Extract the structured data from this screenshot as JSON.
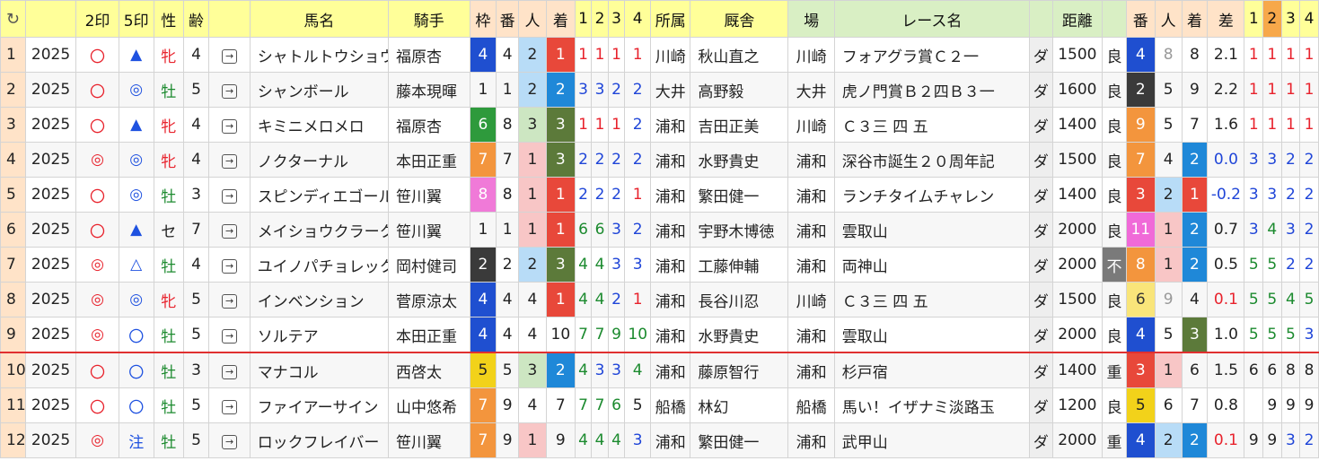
{
  "headers": {
    "refresh": "↻",
    "blank": "",
    "mark2": "2印",
    "mark5": "5印",
    "sex": "性",
    "age": "齢",
    "link": "",
    "horse": "馬名",
    "jockey": "騎手",
    "frame": "枠",
    "number": "番",
    "popularity": "人",
    "finish": "着",
    "c1": "1",
    "c2": "2",
    "c3": "3",
    "c4": "4",
    "belong": "所属",
    "stable": "厩舎",
    "venue": "場",
    "race": "レース名",
    "track": "",
    "distance": "距離",
    "cond": "",
    "pnum": "番",
    "ppop": "人",
    "pfin": "着",
    "diff": "差",
    "p1": "1",
    "p2": "2",
    "p3": "3",
    "p4": "4"
  },
  "rows": [
    {
      "no": "1",
      "year": "2025",
      "m2": "〇",
      "m5": "▲",
      "sex": "牝",
      "age": "4",
      "horse": "シャトルトウショウ",
      "jockey": "福原杏",
      "frame": "4",
      "num": "4",
      "pop": "2",
      "fin": "1",
      "c1": "1",
      "c2": "1",
      "c3": "1",
      "c4": "1",
      "belong": "川崎",
      "stable": "秋山直之",
      "venue": "川崎",
      "race": "フォアグラ賞Ｃ２一",
      "track": "ダ",
      "dist": "1500",
      "cond": "良",
      "pnum": "4",
      "ppop": "8",
      "pfin": "8",
      "diff": "2.1",
      "p1": "1",
      "p2": "1",
      "p3": "1",
      "p4": "1"
    },
    {
      "no": "2",
      "year": "2025",
      "m2": "〇",
      "m5": "◎",
      "sex": "牡",
      "age": "5",
      "horse": "シャンボール",
      "jockey": "藤本現暉",
      "frame": "1",
      "num": "1",
      "pop": "2",
      "fin": "2",
      "c1": "3",
      "c2": "3",
      "c3": "2",
      "c4": "2",
      "belong": "大井",
      "stable": "高野毅",
      "venue": "大井",
      "race": "虎ノ門賞Ｂ２四Ｂ３一",
      "track": "ダ",
      "dist": "1600",
      "cond": "良",
      "pnum": "2",
      "ppop": "5",
      "pfin": "9",
      "diff": "2.2",
      "p1": "1",
      "p2": "1",
      "p3": "1",
      "p4": "1"
    },
    {
      "no": "3",
      "year": "2025",
      "m2": "〇",
      "m5": "▲",
      "sex": "牝",
      "age": "4",
      "horse": "キミニメロメロ",
      "jockey": "福原杏",
      "frame": "6",
      "num": "8",
      "pop": "3",
      "fin": "3",
      "c1": "1",
      "c2": "1",
      "c3": "1",
      "c4": "2",
      "belong": "浦和",
      "stable": "吉田正美",
      "venue": "川崎",
      "race": "Ｃ３三 四 五",
      "track": "ダ",
      "dist": "1400",
      "cond": "良",
      "pnum": "9",
      "ppop": "5",
      "pfin": "7",
      "diff": "1.6",
      "p1": "1",
      "p2": "1",
      "p3": "1",
      "p4": "1"
    },
    {
      "no": "4",
      "year": "2025",
      "m2": "◎",
      "m5": "◎",
      "sex": "牝",
      "age": "4",
      "horse": "ノクターナル",
      "jockey": "本田正重",
      "frame": "7",
      "num": "7",
      "pop": "1",
      "fin": "3",
      "c1": "2",
      "c2": "2",
      "c3": "2",
      "c4": "2",
      "belong": "浦和",
      "stable": "水野貴史",
      "venue": "浦和",
      "race": "深谷市誕生２０周年記",
      "track": "ダ",
      "dist": "1500",
      "cond": "良",
      "pnum": "7",
      "ppop": "4",
      "pfin": "2",
      "diff": "0.0",
      "p1": "3",
      "p2": "3",
      "p3": "2",
      "p4": "2"
    },
    {
      "no": "5",
      "year": "2025",
      "m2": "〇",
      "m5": "◎",
      "sex": "牡",
      "age": "3",
      "horse": "スピンディエゴール",
      "jockey": "笹川翼",
      "frame": "8",
      "num": "8",
      "pop": "1",
      "fin": "1",
      "c1": "2",
      "c2": "2",
      "c3": "2",
      "c4": "1",
      "belong": "浦和",
      "stable": "繁田健一",
      "venue": "浦和",
      "race": "ランチタイムチャレン",
      "track": "ダ",
      "dist": "1400",
      "cond": "良",
      "pnum": "3",
      "ppop": "2",
      "pfin": "1",
      "diff": "-0.2",
      "p1": "3",
      "p2": "3",
      "p3": "2",
      "p4": "2"
    },
    {
      "no": "6",
      "year": "2025",
      "m2": "〇",
      "m5": "▲",
      "sex": "セ",
      "age": "7",
      "horse": "メイショウクラーク",
      "jockey": "笹川翼",
      "frame": "1",
      "num": "1",
      "pop": "1",
      "fin": "1",
      "c1": "6",
      "c2": "6",
      "c3": "3",
      "c4": "2",
      "belong": "浦和",
      "stable": "宇野木博徳",
      "venue": "浦和",
      "race": "雲取山",
      "track": "ダ",
      "dist": "2000",
      "cond": "良",
      "pnum": "11",
      "ppop": "1",
      "pfin": "2",
      "diff": "0.7",
      "p1": "3",
      "p2": "4",
      "p3": "3",
      "p4": "2"
    },
    {
      "no": "7",
      "year": "2025",
      "m2": "◎",
      "m5": "△",
      "sex": "牡",
      "age": "4",
      "horse": "ユイノパチョレック",
      "jockey": "岡村健司",
      "frame": "2",
      "num": "2",
      "pop": "2",
      "fin": "3",
      "c1": "4",
      "c2": "4",
      "c3": "3",
      "c4": "3",
      "belong": "浦和",
      "stable": "工藤伸輔",
      "venue": "浦和",
      "race": "両神山",
      "track": "ダ",
      "dist": "2000",
      "cond": "不",
      "pnum": "8",
      "ppop": "1",
      "pfin": "2",
      "diff": "0.5",
      "p1": "5",
      "p2": "5",
      "p3": "2",
      "p4": "2"
    },
    {
      "no": "8",
      "year": "2025",
      "m2": "◎",
      "m5": "◎",
      "sex": "牝",
      "age": "5",
      "horse": "インベンション",
      "jockey": "菅原涼太",
      "frame": "4",
      "num": "4",
      "pop": "4",
      "fin": "1",
      "c1": "4",
      "c2": "4",
      "c3": "2",
      "c4": "1",
      "belong": "浦和",
      "stable": "長谷川忍",
      "venue": "川崎",
      "race": "Ｃ３三 四 五",
      "track": "ダ",
      "dist": "1500",
      "cond": "良",
      "pnum": "6",
      "ppop": "9",
      "pfin": "4",
      "diff": "0.1",
      "p1": "5",
      "p2": "5",
      "p3": "4",
      "p4": "5"
    },
    {
      "no": "9",
      "year": "2025",
      "m2": "◎",
      "m5": "〇",
      "sex": "牡",
      "age": "5",
      "horse": "ソルテア",
      "jockey": "本田正重",
      "frame": "4",
      "num": "4",
      "pop": "4",
      "fin": "10",
      "c1": "7",
      "c2": "7",
      "c3": "9",
      "c4": "10",
      "belong": "浦和",
      "stable": "水野貴史",
      "venue": "浦和",
      "race": "雲取山",
      "track": "ダ",
      "dist": "2000",
      "cond": "良",
      "pnum": "4",
      "ppop": "5",
      "pfin": "3",
      "diff": "1.0",
      "p1": "5",
      "p2": "5",
      "p3": "5",
      "p4": "3"
    },
    {
      "no": "10",
      "year": "2025",
      "m2": "〇",
      "m5": "〇",
      "sex": "牡",
      "age": "3",
      "horse": "マナコル",
      "jockey": "西啓太",
      "frame": "5",
      "num": "5",
      "pop": "3",
      "fin": "2",
      "c1": "4",
      "c2": "3",
      "c3": "3",
      "c4": "4",
      "belong": "浦和",
      "stable": "藤原智行",
      "venue": "浦和",
      "race": "杉戸宿",
      "track": "ダ",
      "dist": "1400",
      "cond": "重",
      "pnum": "3",
      "ppop": "1",
      "pfin": "6",
      "diff": "1.5",
      "p1": "6",
      "p2": "6",
      "p3": "8",
      "p4": "8"
    },
    {
      "no": "11",
      "year": "2025",
      "m2": "〇",
      "m5": "〇",
      "sex": "牡",
      "age": "5",
      "horse": "ファイアーサイン",
      "jockey": "山中悠希",
      "frame": "7",
      "num": "9",
      "pop": "4",
      "fin": "7",
      "c1": "7",
      "c2": "7",
      "c3": "6",
      "c4": "5",
      "belong": "船橋",
      "stable": "林幻",
      "venue": "船橋",
      "race": "馬い！イザナミ淡路玉",
      "track": "ダ",
      "dist": "1200",
      "cond": "良",
      "pnum": "5",
      "ppop": "6",
      "pfin": "7",
      "diff": "0.8",
      "p1": "",
      "p2": "9",
      "p3": "9",
      "p4": "9"
    },
    {
      "no": "12",
      "year": "2025",
      "m2": "◎",
      "m5": "注",
      "sex": "牡",
      "age": "5",
      "horse": "ロックフレイバー",
      "jockey": "笹川翼",
      "frame": "7",
      "num": "9",
      "pop": "1",
      "fin": "9",
      "c1": "4",
      "c2": "4",
      "c3": "4",
      "c4": "3",
      "belong": "浦和",
      "stable": "繁田健一",
      "venue": "浦和",
      "race": "武甲山",
      "track": "ダ",
      "dist": "2000",
      "cond": "重",
      "pnum": "4",
      "ppop": "2",
      "pfin": "2",
      "diff": "0.1",
      "p1": "9",
      "p2": "9",
      "p3": "3",
      "p4": "2"
    }
  ],
  "colors": {
    "header_yellow": "#ffff99",
    "header_green": "#d9efc4",
    "header_num": "#ffe3c8",
    "frame_blue": "#1f4fd0",
    "finish_red": "#e8483a",
    "separator": "#e03030"
  },
  "icons": {
    "refresh": "refresh-icon",
    "arrow": "arrow-box-icon"
  }
}
